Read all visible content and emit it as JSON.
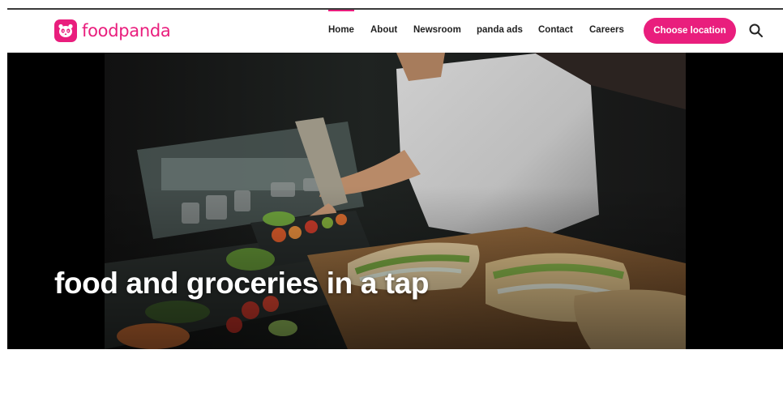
{
  "brand": {
    "name": "foodpanda",
    "color": "#e91e7d"
  },
  "nav": {
    "items": [
      {
        "label": "Home",
        "active": true
      },
      {
        "label": "About",
        "active": false
      },
      {
        "label": "Newsroom",
        "active": false
      },
      {
        "label": "panda ads",
        "active": false
      },
      {
        "label": "Contact",
        "active": false
      },
      {
        "label": "Careers",
        "active": false
      }
    ],
    "cta_label": "Choose location",
    "search_icon": "search-icon"
  },
  "hero": {
    "title": "food and groceries in a tap",
    "image": "chef-preparing-food-photo"
  }
}
